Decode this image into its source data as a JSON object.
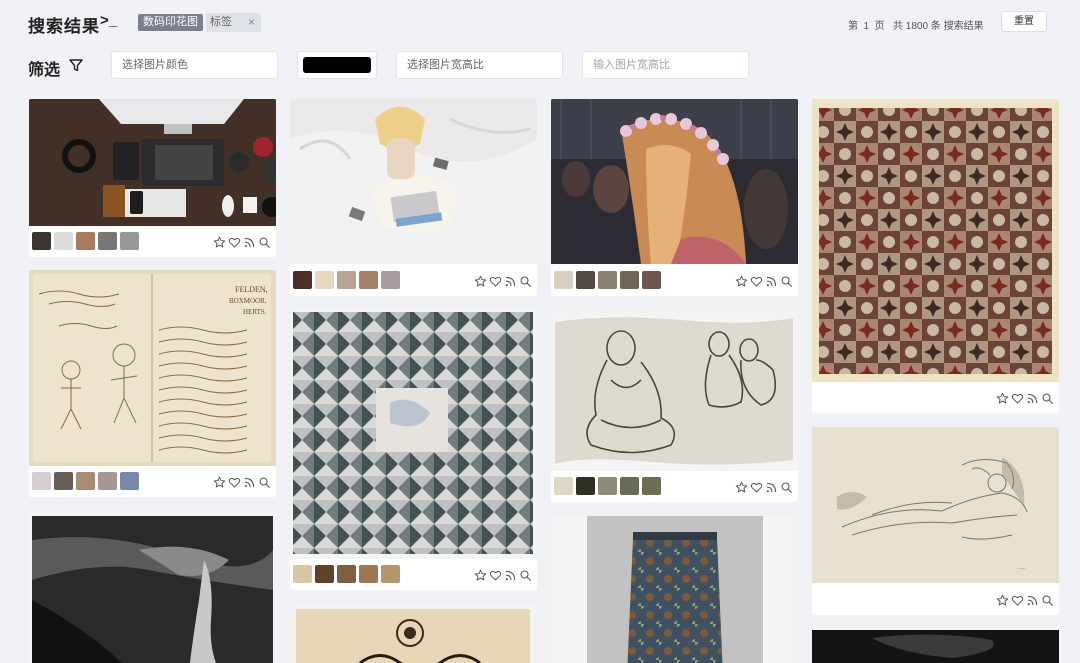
{
  "header": {
    "title": "搜索结果",
    "prompt": ">_",
    "tag_active": "数码印花图",
    "tag_secondary": "标签",
    "tag_close": "×",
    "pageinfo": "第  1  页   共 1800 条 搜索结果",
    "reset": "重置"
  },
  "filters": {
    "label": "筛选",
    "color_input": "选择图片颜色",
    "selected_color": "#000000",
    "ratio_select": "选择图片宽高比",
    "ratio_input_placeholder": "输入图片宽高比"
  },
  "cards": [
    {
      "subject": "desk-tech",
      "palette": [
        "#3a3330",
        "#dcdcda",
        "#a87b60",
        "#7a7877",
        "#959a96"
      ]
    },
    {
      "subject": "woman-laptop-bed",
      "palette": [
        "#d5cdd1",
        "#6a5c59",
        "#a98a74",
        "#a79693",
        "#7589a7"
      ]
    },
    {
      "subject": "flower-crown",
      "palette": [
        "#514541",
        "#f2c8b5",
        "#d08876",
        "#8c5f53",
        "#e18fb4"
      ]
    },
    {
      "subject": "patchwork-quilt-brown",
      "palette": [
        "#4b3027",
        "#e7d8c0",
        "#b6a592",
        "#a6806a",
        "#a89a9e"
      ]
    },
    {
      "subject": "letter-sketch",
      "palette": [
        "#d9c6a5",
        "#5f4328",
        "#7f5e40",
        "#9c774f",
        "#b59570"
      ]
    },
    {
      "subject": "patchwork-quilt-blue",
      "palette": [
        "#b8b2b0",
        "#28353a",
        "#5f6a6b",
        "#7b6b3c",
        "#5a4a40"
      ]
    },
    {
      "subject": "figure-sketch",
      "palette": [
        "#d7d0c2",
        "#554a42",
        "#8c8070",
        "#716556",
        "#6d5850"
      ]
    },
    {
      "subject": "reclining-nude-print",
      "palette": [
        "#ddd8c6",
        "#2f3025",
        "#8d8b77",
        "#6a6b57",
        "#6e6d52"
      ]
    },
    {
      "subject": "dark-lithograph",
      "palette": []
    },
    {
      "subject": "old-book",
      "palette": []
    },
    {
      "subject": "textile-panel",
      "palette": []
    },
    {
      "subject": "dark-photo",
      "palette": []
    }
  ]
}
